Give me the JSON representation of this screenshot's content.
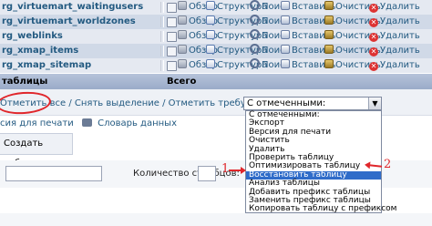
{
  "tables": [
    {
      "name": "rg_virtuemart_waitingusers"
    },
    {
      "name": "rg_virtuemart_worldzones"
    },
    {
      "name": "rg_weblinks"
    },
    {
      "name": "rg_xmap_items"
    },
    {
      "name": "rg_xmap_sitemap"
    }
  ],
  "actions": {
    "browse": "Обзор",
    "structure": "Структура",
    "search": "Поиск",
    "insert": "Вставить",
    "empty": "Очистить",
    "drop": "Удалить"
  },
  "header": {
    "tables_label": "таблицы",
    "total_label": "Всего"
  },
  "selection_links": {
    "check_all": "Отметить все",
    "uncheck_all": "Снять выделение",
    "check_overhead": "Отметить требующие оптимизации"
  },
  "with_selected": {
    "value": "С отмеченными:",
    "options": [
      "С отмеченными:",
      "Экспорт",
      "Версия для печати",
      "Очистить",
      "Удалить",
      "Проверить таблицу",
      "Оптимизировать таблицу",
      "Восстановить таблицу",
      "Анализ таблицы",
      "Добавить префикс таблицы",
      "Заменить префикс таблицы",
      "Копировать таблицу с префиксом"
    ],
    "highlighted_index": 7
  },
  "print_links": {
    "print_view": "сия для печати",
    "data_dictionary": "Словарь данных"
  },
  "create_table": {
    "title": "Создать таблицу",
    "columns_label": "Количество столбцов:"
  },
  "annotations": {
    "mark1": "1",
    "mark2": "2"
  },
  "colors": {
    "link": "#235a81",
    "highlight": "#2f6cc9",
    "annotation": "#e0262b"
  }
}
